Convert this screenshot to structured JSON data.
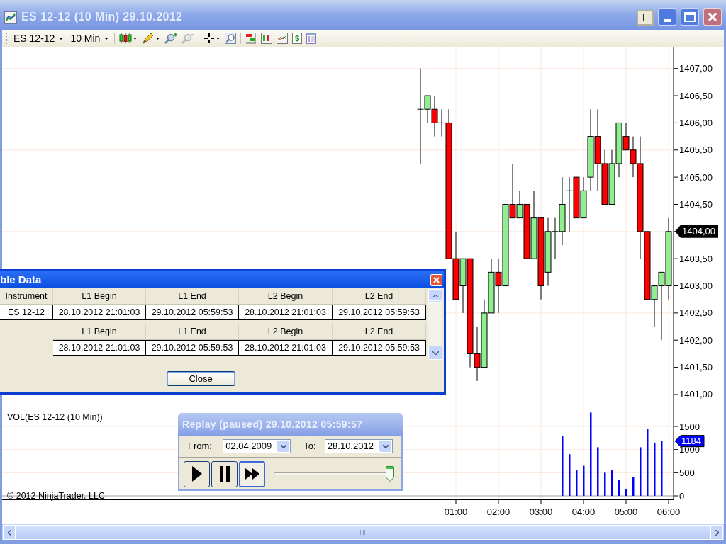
{
  "window": {
    "title": "ES 12-12 (10 Min)  29.10.2012",
    "link_button": "L"
  },
  "toolbar": {
    "instrument": "ES 12-12",
    "interval": "10 Min",
    "money_glyph": "$"
  },
  "price_panel": {
    "last_price": "1404,00",
    "chart_data": {
      "type": "candlestick",
      "grid": true,
      "x": [
        10,
        20,
        30,
        40,
        50,
        60,
        70,
        80,
        90,
        100,
        110,
        120,
        130,
        140,
        150,
        160,
        170,
        180,
        190,
        200,
        210,
        220,
        230,
        240,
        250,
        260,
        270,
        280,
        290,
        300,
        310,
        320,
        330,
        340,
        350,
        360
      ],
      "xlim": [
        -580,
        438
      ],
      "ohlc": [
        [
          1406.25,
          1407,
          1405.25,
          1406.25
        ],
        [
          1406.25,
          1406.5,
          1406,
          1406.5
        ],
        [
          1406.25,
          1406.5,
          1405.75,
          1406
        ],
        [
          1406,
          1406.25,
          1405.75,
          1406
        ],
        [
          1406,
          1406.25,
          1403.5,
          1403.5
        ],
        [
          1403.5,
          1404,
          1402.75,
          1402.75
        ],
        [
          1403,
          1403.5,
          1402.5,
          1403.5
        ],
        [
          1403.5,
          1403.5,
          1401.5,
          1401.75
        ],
        [
          1401.75,
          1402.25,
          1401.25,
          1401.5
        ],
        [
          1401.5,
          1402.75,
          1401.5,
          1402.5
        ],
        [
          1402.5,
          1403.5,
          1402.5,
          1403.25
        ],
        [
          1403.25,
          1403.5,
          1402.5,
          1403
        ],
        [
          1403,
          1404.5,
          1403,
          1404.5
        ],
        [
          1404.5,
          1405.25,
          1404.25,
          1404.25
        ],
        [
          1404.25,
          1404.75,
          1404.25,
          1404.5
        ],
        [
          1404.5,
          1404.5,
          1403.5,
          1403.5
        ],
        [
          1403.5,
          1404.75,
          1403.5,
          1404.25
        ],
        [
          1404.25,
          1404.25,
          1402.75,
          1403
        ],
        [
          1403.25,
          1404.25,
          1403,
          1404
        ],
        [
          1404,
          1404.25,
          1403.5,
          1404
        ],
        [
          1404,
          1405,
          1403.75,
          1404.5
        ],
        [
          1404.75,
          1405,
          1404,
          1404.75
        ],
        [
          1405,
          1405,
          1404.25,
          1404.25
        ],
        [
          1404.25,
          1405,
          1404.25,
          1404.75
        ],
        [
          1405,
          1406.25,
          1404.75,
          1405.75
        ],
        [
          1405.75,
          1406.25,
          1404.75,
          1405.25
        ],
        [
          1405.25,
          1405.5,
          1404.5,
          1404.5
        ],
        [
          1404.5,
          1405.5,
          1404.5,
          1405.25
        ],
        [
          1405.25,
          1406,
          1405,
          1406
        ],
        [
          1405.75,
          1406,
          1405.5,
          1405.5
        ],
        [
          1405.5,
          1405.75,
          1405,
          1405.25
        ],
        [
          1405.25,
          1405.75,
          1403.5,
          1404
        ],
        [
          1404,
          1404,
          1402.75,
          1402.75
        ],
        [
          1402.75,
          1403,
          1402.25,
          1403
        ],
        [
          1403,
          1403.25,
          1402,
          1403.25
        ],
        [
          1403,
          1404.25,
          1402.75,
          1404
        ]
      ],
      "ylim": [
        1400.83,
        1407.4
      ],
      "yticks": [
        {
          "value": 1407,
          "label": "1407,00"
        },
        {
          "value": 1406.5,
          "label": "1406,50"
        },
        {
          "value": 1406,
          "label": "1406,00"
        },
        {
          "value": 1405.5,
          "label": "1405,50"
        },
        {
          "value": 1405,
          "label": "1405,00"
        },
        {
          "value": 1404.5,
          "label": "1404,50"
        },
        {
          "value": 1403.5,
          "label": "1403,50"
        },
        {
          "value": 1403,
          "label": "1403,00"
        },
        {
          "value": 1402.5,
          "label": "1402,50"
        },
        {
          "value": 1402,
          "label": "1402,00"
        },
        {
          "value": 1401.5,
          "label": "1401,50"
        },
        {
          "value": 1401,
          "label": "1401,00"
        }
      ]
    }
  },
  "volume_panel": {
    "title": "VOL(ES 12-12 (10 Min))",
    "last_volume": "1184",
    "copyright": "© 2012 NinjaTrader, LLC",
    "chart_data": {
      "type": "bar",
      "grid": true,
      "x": [
        210,
        220,
        230,
        240,
        250,
        260,
        270,
        280,
        290,
        300,
        310,
        320,
        330,
        340,
        350
      ],
      "xlim": [
        -580,
        438
      ],
      "values": [
        1300,
        900,
        550,
        650,
        1800,
        1050,
        500,
        550,
        350,
        150,
        400,
        1050,
        1450,
        1150,
        1184
      ],
      "ylim": [
        0,
        1990
      ],
      "yticks": [
        0,
        500,
        1000,
        1500
      ],
      "xticks": [
        {
          "value": 60,
          "label": "01:00"
        },
        {
          "value": 120,
          "label": "02:00"
        },
        {
          "value": 180,
          "label": "03:00"
        },
        {
          "value": 240,
          "label": "04:00"
        },
        {
          "value": 300,
          "label": "05:00"
        },
        {
          "value": 360,
          "label": "06:00"
        }
      ]
    }
  },
  "data_dialog": {
    "title": "ble Data",
    "columns": [
      "Instrument",
      "L1 Begin",
      "L1 End",
      "L2 Begin",
      "L2 End"
    ],
    "rows": [
      [
        "ES 12-12",
        "28.10.2012 21:01:03",
        "29.10.2012 05:59:53",
        "28.10.2012 21:01:03",
        "29.10.2012 05:59:53"
      ]
    ],
    "sub_columns": [
      "L1 Begin",
      "L1 End",
      "L2 Begin",
      "L2 End"
    ],
    "sub_rows": [
      [
        "28.10.2012 21:01:03",
        "29.10.2012 05:59:53",
        "28.10.2012 21:01:03",
        "29.10.2012 05:59:53"
      ]
    ],
    "close_button": "Close"
  },
  "replay": {
    "title": "Replay (paused) 29.10.2012 05:59:57",
    "from_label": "From:",
    "from_value": "02.04.2009",
    "to_label": "To:",
    "to_value": "28.10.2012",
    "buttons": [
      {
        "kind": "play",
        "selected": false
      },
      {
        "kind": "pause",
        "selected": false
      },
      {
        "kind": "fast_forward",
        "selected": true
      }
    ],
    "speed": {
      "level": 1
    }
  }
}
